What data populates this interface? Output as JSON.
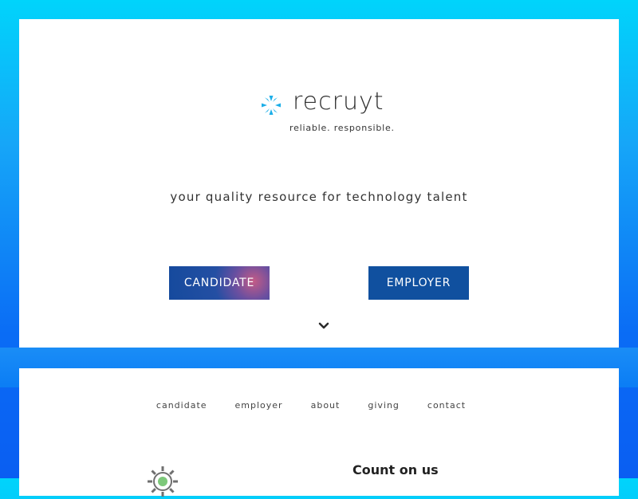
{
  "brand": {
    "name": "recruyt",
    "tagline": "reliable. responsible."
  },
  "hero": {
    "headline": "your quality resource for technology talent",
    "buttons": {
      "candidate": "CANDIDATE",
      "employer": "EMPLOYER"
    },
    "scroll_icon": "chevron-down-icon"
  },
  "nav": {
    "items": [
      "candidate",
      "employer",
      "about",
      "giving",
      "contact"
    ]
  },
  "section": {
    "heading": "Count on us"
  },
  "colors": {
    "brand_blue": "#1caee8",
    "button_blue": "#10509f",
    "text": "#333333"
  }
}
